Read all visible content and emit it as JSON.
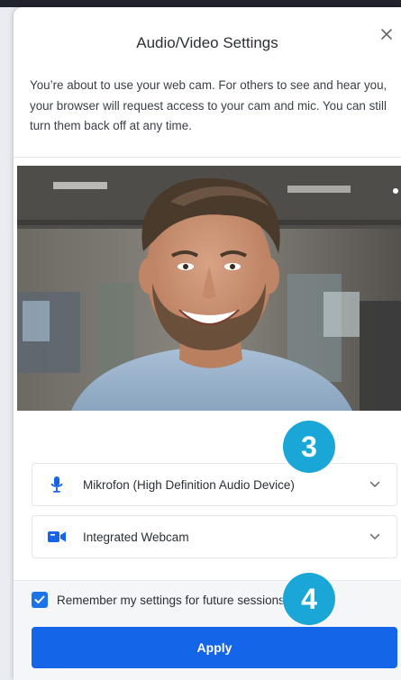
{
  "dialog": {
    "title": "Audio/Video Settings",
    "description": "You’re about to use your web cam. For others to see and hear you, your browser will request access to your cam and mic. You can still turn them back off at any time.",
    "close_icon": "close-icon"
  },
  "devices": {
    "microphone": {
      "icon": "microphone-icon",
      "label": "Mikrofon (High Definition Audio Device)"
    },
    "camera": {
      "icon": "video-camera-icon",
      "label": "Integrated Webcam"
    }
  },
  "remember": {
    "label": "Remember my settings for future sessions",
    "checked": true
  },
  "apply": {
    "label": "Apply"
  },
  "callouts": [
    "3",
    "4"
  ],
  "colors": {
    "accent": "#1565e8",
    "badge": "#1aa7d8"
  }
}
